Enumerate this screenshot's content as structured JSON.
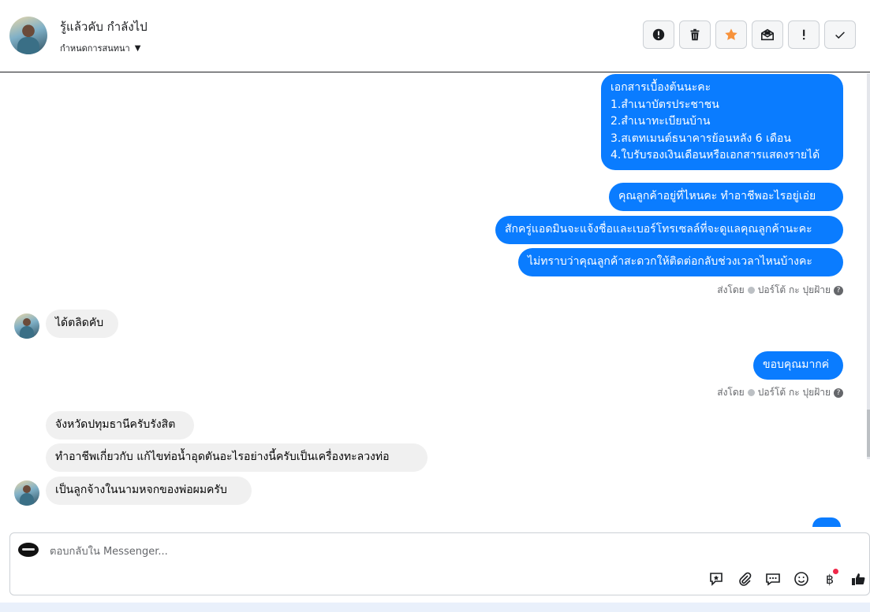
{
  "header": {
    "contact_name": "รู้แล้วคับ กำลังไป",
    "assign_label": "กำหนดการสนทนา",
    "actions": [
      {
        "name": "spam-button",
        "icon": "alert-circle-icon"
      },
      {
        "name": "delete-button",
        "icon": "trash-icon"
      },
      {
        "name": "star-button",
        "icon": "star-icon",
        "color": "#f7923b"
      },
      {
        "name": "mark-unread-button",
        "icon": "envelope-open-icon"
      },
      {
        "name": "mark-important-button",
        "icon": "exclamation-icon"
      },
      {
        "name": "mark-done-button",
        "icon": "check-icon"
      }
    ]
  },
  "messages": {
    "out_docs": [
      "เอกสารเบื้องต้นนะคะ",
      "1.สำเนาบัตรประชาชน",
      "2.สำเนาทะเบียนบ้าน",
      "3.สเตทเมนต์ธนาคารย้อนหลัง 6 เดือน",
      "4.ใบรับรองเงินเดือนหรือเอกสารแสดงรายได้"
    ],
    "out_1": "คุณลูกค้าอยู่ที่ไหนคะ ทำอาชีพอะไรอยู่เอ่ย",
    "out_2": "สักครู่แอดมินจะแจ้งชื่อและเบอร์โทรเซลล์ที่จะดูแลคุณลูกค้านะคะ",
    "out_3": "ไม่ทราบว่าคุณลูกค้าสะดวกให้ติดต่อกลับช่วงเวลาไหนบ้างคะ",
    "sent_by_1": {
      "prefix": "ส่งโดย",
      "name": "ปอร์โต้ กะ ปุยฝ้าย"
    },
    "in_1": "ได้ตลิดคับ",
    "out_4": "ขอบคุณมากค่",
    "sent_by_2": {
      "prefix": "ส่งโดย",
      "name": "ปอร์โต้ กะ ปุยฝ้าย"
    },
    "in_2": "จังหวัดปทุมธานีครับรังสิต",
    "in_3": "ทำอาชีพเกี่ยวกับ แก้ไขท่อน้ำอุดตันอะไรอย่างนี้ครับเป็นเครื่องทะลวงท่อ",
    "in_4": "เป็นลูกจ้างในนามหจกของพ่อผมครับ"
  },
  "composer": {
    "placeholder": "ตอบกลับใน Messenger...",
    "tools": [
      "saved-reply-icon",
      "paperclip-icon",
      "chat-bubbles-icon",
      "emoji-icon",
      "baht-icon",
      "thumbs-up-icon"
    ]
  },
  "colors": {
    "outgoing": "#0a7cff",
    "incoming": "#f0f0f0",
    "star": "#f7923b",
    "notification": "#f02849"
  }
}
